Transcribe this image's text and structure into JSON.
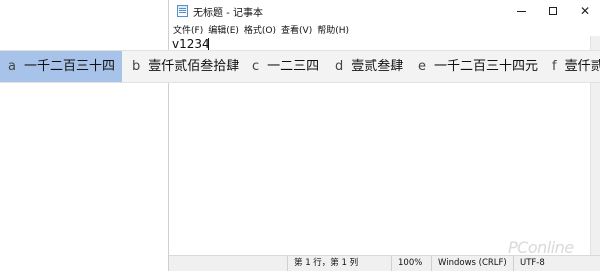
{
  "window": {
    "title": "无标题 - 记事本",
    "icon": "notepad-icon",
    "controls": [
      "minimize-icon",
      "maximize-icon",
      "close-icon"
    ],
    "close_glyph": "✕"
  },
  "menu": [
    "文件(F)",
    "编辑(E)",
    "格式(O)",
    "查看(V)",
    "帮助(H)"
  ],
  "editor": {
    "text": "v1234"
  },
  "status": {
    "position": "第 1 行，第 1 列",
    "zoom": "100%",
    "line_ending": "Windows (CRLF)",
    "encoding": "UTF-8"
  },
  "ime": {
    "selected_index": 0,
    "selected_color": "#a7c3ea",
    "candidates": [
      {
        "key": "a",
        "text": "一千二百三十四"
      },
      {
        "key": "b",
        "text": "壹仟贰佰叁拾肆"
      },
      {
        "key": "c",
        "text": "一二三四"
      },
      {
        "key": "d",
        "text": "壹贰叁肆"
      },
      {
        "key": "e",
        "text": "一千二百三十四元"
      },
      {
        "key": "f",
        "text": "壹仟贰"
      }
    ]
  },
  "watermark": "PConline"
}
